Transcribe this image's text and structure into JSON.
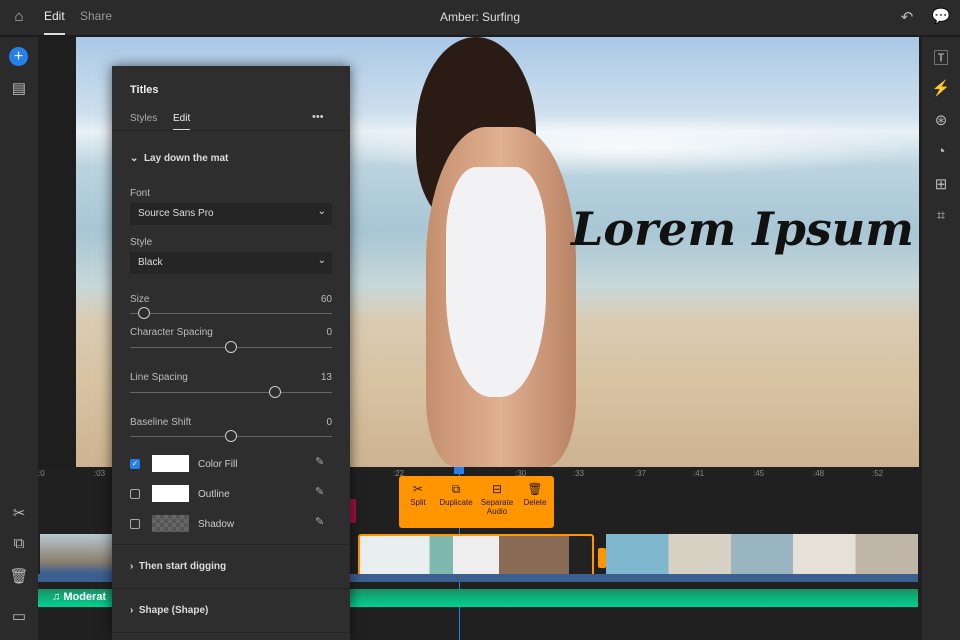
{
  "topbar": {
    "tabs": [
      {
        "label": "Edit",
        "active": true
      },
      {
        "label": "Share",
        "active": false
      }
    ],
    "title": "Amber: Surfing"
  },
  "preview": {
    "title_text": "Lorem Ipsum"
  },
  "panel": {
    "title": "Titles",
    "tabs": [
      "Styles",
      "Edit"
    ],
    "more": "•••",
    "section1": "Lay down the mat",
    "font_label": "Font",
    "font_value": "Source Sans Pro",
    "style_label": "Style",
    "style_value": "Black",
    "sliders": [
      {
        "label": "Size",
        "value": "60",
        "fraction": 0.07
      },
      {
        "label": "Character Spacing",
        "value": "0",
        "fraction": 0.5
      },
      {
        "label": "Line Spacing",
        "value": "13",
        "fraction": 0.72
      },
      {
        "label": "Baseline Shift",
        "value": "0",
        "fraction": 0.5
      }
    ],
    "fills": [
      {
        "label": "Color Fill",
        "checked": true
      },
      {
        "label": "Outline",
        "checked": false
      },
      {
        "label": "Shadow",
        "checked": false
      }
    ],
    "section2": "Then start digging",
    "section3": "Shape (Shape)"
  },
  "timeline": {
    "ticks": [
      ":0",
      ":03",
      ":22",
      ":30",
      ":33",
      ":37",
      ":41",
      ":45",
      ":48",
      ":52"
    ],
    "actions": [
      "Split",
      "Duplicate",
      "Separate Audio",
      "Delete"
    ],
    "audio_label": "Moderat"
  },
  "colors": {
    "accent": "#2680eb",
    "selection": "#ff9500",
    "audio": "#00d392"
  }
}
